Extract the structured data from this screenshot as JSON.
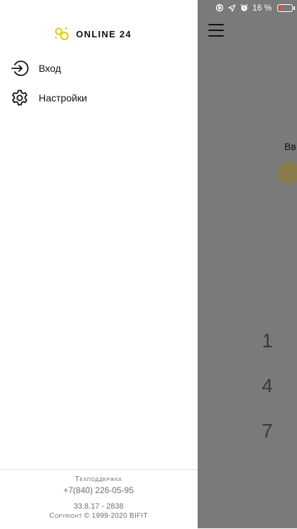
{
  "status_bar": {
    "battery_percent_text": "16 %",
    "battery_level": 0.16,
    "icons": [
      "rotation-lock-icon",
      "location-arrow-icon",
      "alarm-icon",
      "battery-icon"
    ]
  },
  "drawer": {
    "brand": {
      "text": "ONLINE 24",
      "logo_color": "#e6cf00"
    },
    "menu": [
      {
        "label": "Вход",
        "icon": "login-icon"
      },
      {
        "label": "Настройки",
        "icon": "gear-icon"
      }
    ],
    "footer": {
      "support_title": "Техподдержка",
      "support_phone": "+7(840) 226-05-95",
      "version": "33.8.17 - 2838",
      "copyright": "Copyright © 1999-2020 BIFIT"
    }
  },
  "background": {
    "partial_prompt_text": "Вв",
    "keypad_digits": [
      "1",
      "4",
      "7"
    ],
    "overlay_color": "#7a7a7a",
    "pin_dot_color": "#8c7c4c"
  }
}
